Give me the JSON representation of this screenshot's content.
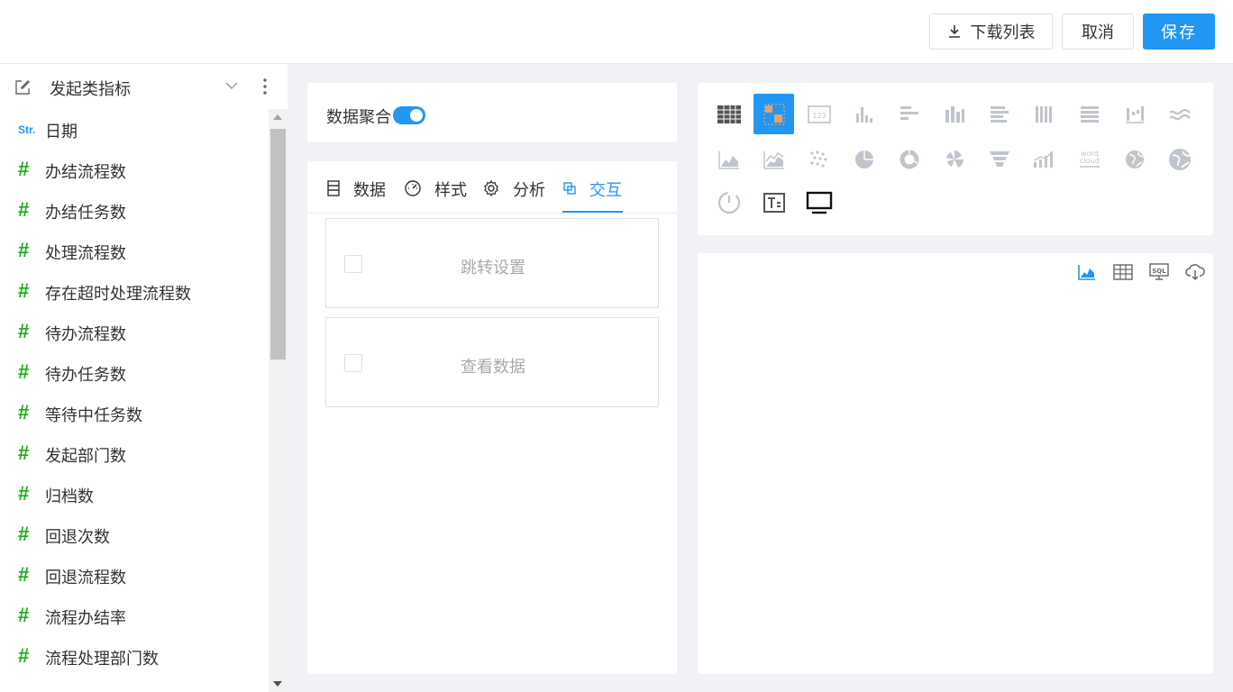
{
  "header": {
    "download_label": "下载列表",
    "cancel_label": "取消",
    "save_label": "保存"
  },
  "sidebar": {
    "title": "发起类指标",
    "items": [
      {
        "type": "Str.",
        "label": "日期"
      },
      {
        "type": "#",
        "label": "办结流程数"
      },
      {
        "type": "#",
        "label": "办结任务数"
      },
      {
        "type": "#",
        "label": "处理流程数"
      },
      {
        "type": "#",
        "label": "存在超时处理流程数"
      },
      {
        "type": "#",
        "label": "待办流程数"
      },
      {
        "type": "#",
        "label": "待办任务数"
      },
      {
        "type": "#",
        "label": "等待中任务数"
      },
      {
        "type": "#",
        "label": "发起部门数"
      },
      {
        "type": "#",
        "label": "归档数"
      },
      {
        "type": "#",
        "label": "回退次数"
      },
      {
        "type": "#",
        "label": "回退流程数"
      },
      {
        "type": "#",
        "label": "流程办结率"
      },
      {
        "type": "#",
        "label": "流程处理部门数"
      }
    ]
  },
  "aggregation": {
    "label": "数据聚合",
    "enabled": true
  },
  "tabs": [
    {
      "label": "数据",
      "icon": "data-sheet-icon"
    },
    {
      "label": "样式",
      "icon": "gauge-icon"
    },
    {
      "label": "分析",
      "icon": "gear-icon"
    },
    {
      "label": "交互",
      "icon": "copy-squares-icon",
      "active": true
    }
  ],
  "interaction_options": [
    {
      "label": "跳转设置",
      "checked": false
    },
    {
      "label": "查看数据",
      "checked": false
    }
  ],
  "chart_types": [
    "table-icon",
    "pivot-table-icon",
    "kpi-card-icon",
    "column-chart-icon",
    "bar-chart-icon",
    "grouped-column-icon",
    "horizontal-bar-icon",
    "stacked-column-icon",
    "stacked-bar-icon",
    "waterfall-icon",
    "wave-icon",
    "area-chart-icon",
    "line-area-icon",
    "scatter-icon",
    "pie-chart-icon",
    "donut-chart-icon",
    "rose-chart-icon",
    "funnel-icon",
    "progress-bars-icon",
    "word-cloud-icon",
    "globe-icon",
    "world-map-icon",
    "gauge-meter-icon",
    "text-card-icon",
    "monitor-icon"
  ],
  "colors": {
    "accent": "#2196f3",
    "measure": "#1aad19",
    "icon_muted": "#c0c4cc"
  }
}
